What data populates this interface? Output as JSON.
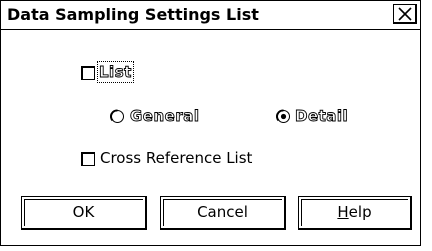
{
  "dialog": {
    "title": "Data Sampling Settings List",
    "close_glyph": "×"
  },
  "options": {
    "list_label": "List",
    "list_checked": false,
    "general_label": "General",
    "general_selected": false,
    "detail_label": "Detail",
    "detail_selected": true,
    "cross_reference_label": "Cross Reference List",
    "cross_reference_checked": false
  },
  "buttons": {
    "ok_label": "OK",
    "cancel_label": "Cancel",
    "help_label": "Help"
  }
}
